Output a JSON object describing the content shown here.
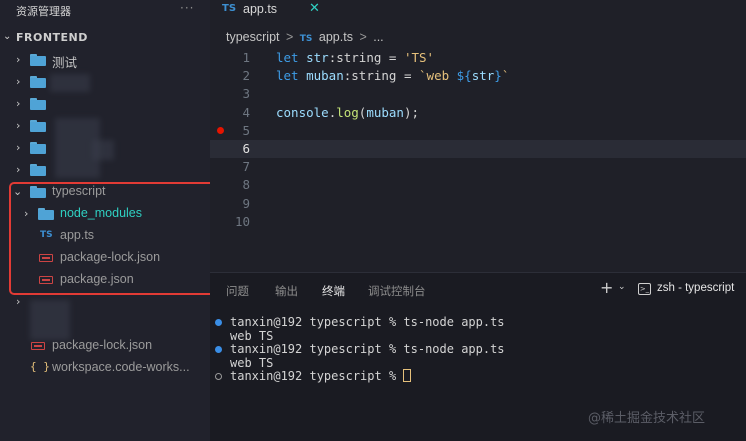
{
  "sidebar": {
    "title": "资源管理器",
    "more": "···",
    "root_label": "FRONTEND",
    "items": [
      {
        "label": "测试"
      },
      {
        "label": "typescript"
      },
      {
        "label": "node_modules"
      },
      {
        "label": "app.ts",
        "badge": "TS"
      },
      {
        "label": "package-lock.json"
      },
      {
        "label": "package.json"
      },
      {
        "label": "package-lock.json"
      },
      {
        "label": "workspace.code-works...",
        "badge": "{ }"
      }
    ]
  },
  "editor": {
    "tab": {
      "badge": "TS",
      "label": "app.ts",
      "close": "✕"
    },
    "breadcrumb": {
      "folder": "typescript",
      "sep": ">",
      "badge": "TS",
      "file": "app.ts",
      "more": "..."
    },
    "lines": [
      {
        "n": "1",
        "tokens": [
          [
            "kw",
            "let "
          ],
          [
            "var",
            "str"
          ],
          [
            "plain",
            ":"
          ],
          [
            "typ",
            "string"
          ],
          [
            "plain",
            " = "
          ],
          [
            "str",
            "'TS'"
          ]
        ]
      },
      {
        "n": "2",
        "tokens": [
          [
            "kw",
            "let "
          ],
          [
            "var",
            "muban"
          ],
          [
            "plain",
            ":"
          ],
          [
            "typ",
            "string"
          ],
          [
            "plain",
            " = "
          ],
          [
            "str",
            "`web "
          ],
          [
            "kw",
            "${"
          ],
          [
            "var",
            "str"
          ],
          [
            "kw",
            "}"
          ],
          [
            "str",
            "`"
          ]
        ]
      },
      {
        "n": "3",
        "tokens": []
      },
      {
        "n": "4",
        "tokens": [
          [
            "var",
            "console"
          ],
          [
            "plain",
            "."
          ],
          [
            "fn",
            "log"
          ],
          [
            "plain",
            "("
          ],
          [
            "var",
            "muban"
          ],
          [
            "plain",
            ");"
          ]
        ]
      },
      {
        "n": "5",
        "tokens": []
      },
      {
        "n": "6",
        "tokens": []
      },
      {
        "n": "7",
        "tokens": []
      },
      {
        "n": "8",
        "tokens": []
      },
      {
        "n": "9",
        "tokens": []
      },
      {
        "n": "10",
        "tokens": []
      }
    ],
    "active_line": "6"
  },
  "panel": {
    "tabs": [
      "问题",
      "输出",
      "终端",
      "调试控制台"
    ],
    "active_tab": "终端",
    "plus": "+",
    "chevron": "⌄",
    "terminal_icon": ">_",
    "terminal_name": "zsh - typescript",
    "lines": [
      {
        "dot": "blue",
        "text": "tanxin@192 typescript % ts-node app.ts"
      },
      {
        "dot": "",
        "text": "web TS"
      },
      {
        "dot": "blue",
        "text": "tanxin@192 typescript % ts-node app.ts"
      },
      {
        "dot": "",
        "text": "web TS"
      },
      {
        "dot": "hollow",
        "text": "tanxin@192 typescript % "
      }
    ]
  },
  "watermark": "@稀土掘金技术社区",
  "colors": {
    "highlight_box": "#e23b35",
    "breakpoint": "#e51400",
    "teal": "#2fd0c2",
    "ts_blue": "#3d8fd1"
  }
}
